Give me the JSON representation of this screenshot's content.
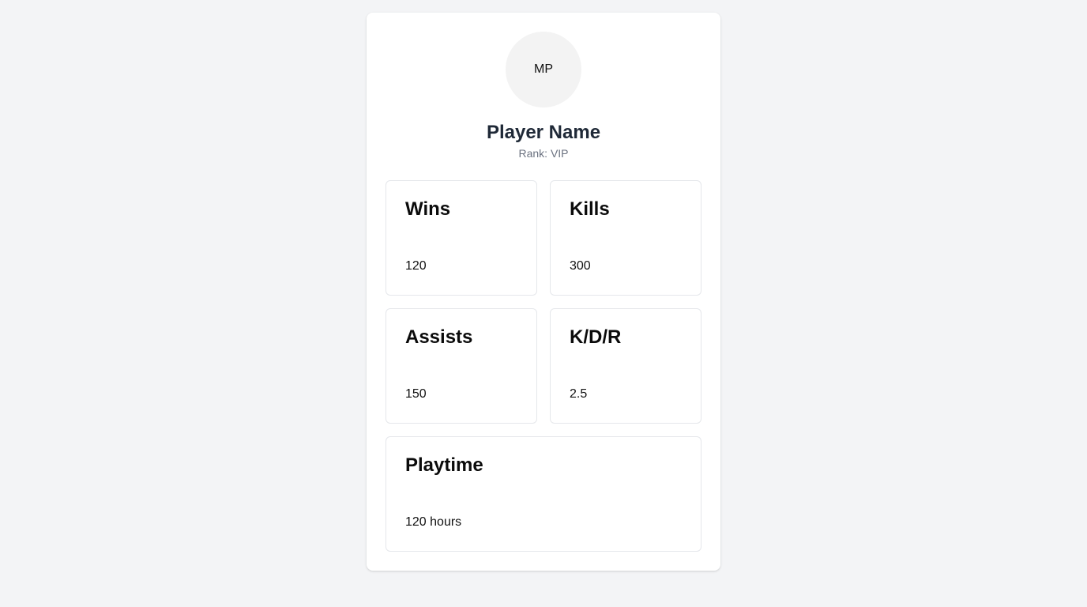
{
  "profile": {
    "initials": "MP",
    "name": "Player Name",
    "rank": "Rank: VIP"
  },
  "stats": [
    {
      "label": "Wins",
      "value": "120"
    },
    {
      "label": "Kills",
      "value": "300"
    },
    {
      "label": "Assists",
      "value": "150"
    },
    {
      "label": "K/D/R",
      "value": "2.5"
    },
    {
      "label": "Playtime",
      "value": "120 hours"
    }
  ],
  "colors": {
    "page_background": "#f3f4f6",
    "card_background": "#ffffff",
    "avatar_background": "#f3f3f3",
    "name_text": "#1f2937",
    "rank_text": "#6b7280",
    "border": "#e5e7eb"
  }
}
